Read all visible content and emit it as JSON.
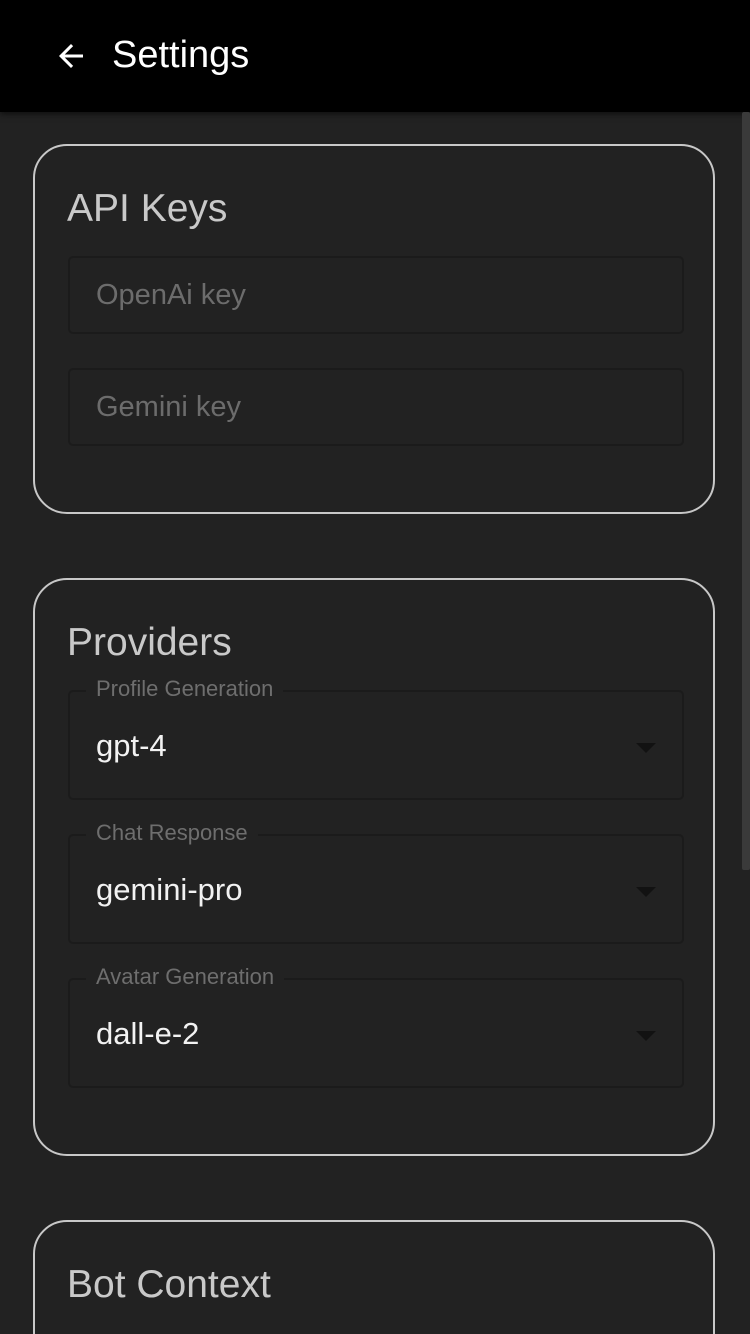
{
  "app_bar": {
    "title": "Settings",
    "back_icon": "arrow-left-icon"
  },
  "api_keys": {
    "title": "API Keys",
    "openai_placeholder": "OpenAi key",
    "openai_value": "",
    "gemini_placeholder": "Gemini key",
    "gemini_value": ""
  },
  "providers": {
    "title": "Providers",
    "profile_generation": {
      "label": "Profile Generation",
      "value": "gpt-4"
    },
    "chat_response": {
      "label": "Chat Response",
      "value": "gemini-pro"
    },
    "avatar_generation": {
      "label": "Avatar Generation",
      "value": "dall-e-2"
    }
  },
  "bot_context": {
    "title": "Bot Context"
  },
  "colors": {
    "background": "#222222",
    "app_bar": "#000000",
    "card_border": "#c8c8c8",
    "text_primary": "#f2f2f2",
    "text_secondary": "#6e6e6e"
  }
}
